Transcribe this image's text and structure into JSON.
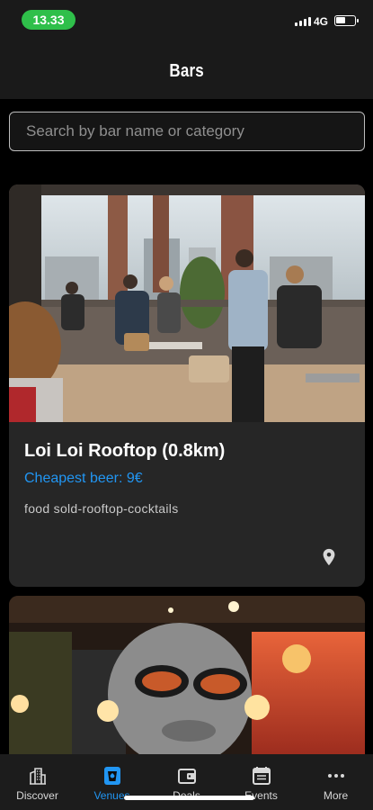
{
  "status": {
    "time": "13.33",
    "network": "4G"
  },
  "header": {
    "title": "Bars"
  },
  "search": {
    "placeholder": "Search by bar name or category"
  },
  "venues": [
    {
      "name": "Loi Loi Rooftop (0.8km)",
      "cheapest": "Cheapest beer: 9€",
      "tags": "food sold-rooftop-cocktails",
      "icon": "location-pin-icon"
    },
    {
      "icon": "photo"
    }
  ],
  "tabs": [
    {
      "label": "Discover",
      "icon": "buildings-icon"
    },
    {
      "label": "Venues",
      "icon": "cup-icon",
      "active": true
    },
    {
      "label": "Deals",
      "icon": "wallet-icon"
    },
    {
      "label": "Events",
      "icon": "calendar-icon"
    },
    {
      "label": "More",
      "icon": "more-dots-icon"
    }
  ],
  "colors": {
    "accent": "#2196f3",
    "time_pill": "#2fbf4a",
    "card": "#262626",
    "background": "#000000"
  }
}
